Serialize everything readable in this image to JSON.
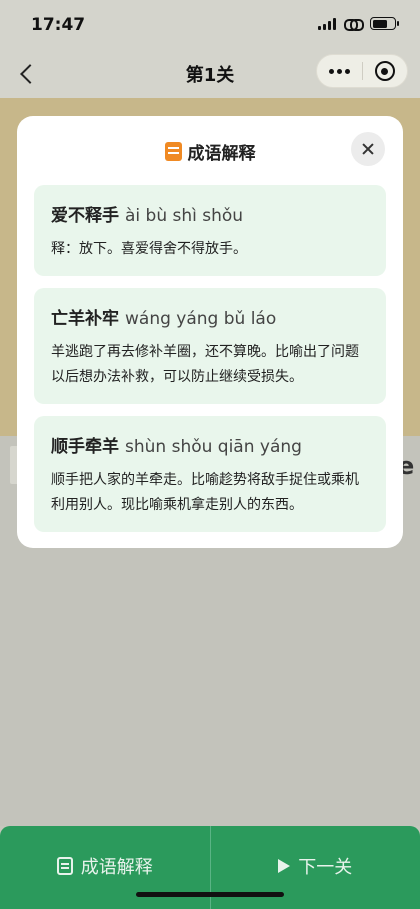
{
  "status_bar": {
    "time": "17:47"
  },
  "nav": {
    "title": "第1关"
  },
  "modal": {
    "title": "成语解释",
    "cards": [
      {
        "idiom": "爱不释手",
        "pinyin": "ài bù shì shǒu",
        "explanation": "释：放下。喜爱得舍不得放手。"
      },
      {
        "idiom": "亡羊补牢",
        "pinyin": "wáng yáng bǔ láo",
        "explanation": "羊逃跑了再去修补羊圈，还不算晚。比喻出了问题以后想办法补救，可以防止继续受损失。"
      },
      {
        "idiom": "顺手牵羊",
        "pinyin": "shùn shǒu qiān yáng",
        "explanation": "顺手把人家的羊牵走。比喻趁势将敌手捉住或乘机利用别人。现比喻乘机拿走别人的东西。"
      }
    ]
  },
  "bottom_bar": {
    "explain_label": "成语解释",
    "next_label": "下一关"
  },
  "background": {
    "peek_right_char": "e"
  },
  "colors": {
    "accent": "#2b9a5c",
    "card_bg": "#e9f6ec",
    "icon_orange": "#f08a24",
    "band_tan": "#c7b78a"
  },
  "icons": [
    "back-arrow-icon",
    "more-dots-icon",
    "target-ring-icon",
    "book-icon",
    "close-icon",
    "play-icon"
  ]
}
